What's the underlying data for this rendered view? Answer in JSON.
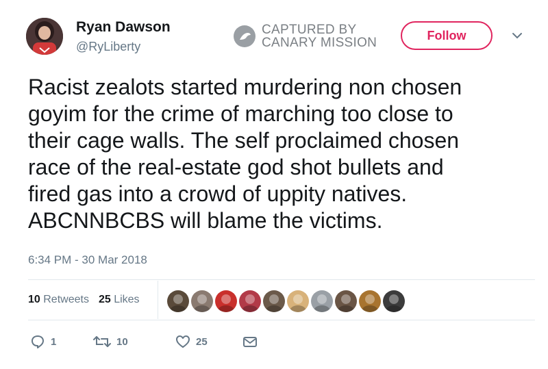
{
  "author": {
    "name": "Ryan Dawson",
    "handle": "@RyLiberty"
  },
  "watermark": {
    "line1": "CAPTURED BY",
    "line2": "CANARY MISSION"
  },
  "follow_button": {
    "label": "Follow"
  },
  "tweet": {
    "text": "Racist zealots started murdering non chosen\ngoyim for the crime of marching too close to\ntheir cage walls. The self proclaimed chosen\nrace of the real-estate god shot bullets and\nfired gas into a crowd of uppity natives.\nABCNNBCBS will blame the victims.",
    "timestamp": "6:34 PM - 30 Mar 2018"
  },
  "stats": {
    "retweets_count": "10",
    "retweets_label": "Retweets",
    "likes_count": "25",
    "likes_label": "Likes"
  },
  "actions": {
    "reply_count": "1",
    "retweet_count": "10",
    "like_count": "25"
  },
  "liker_avatar_colors": [
    "#5a4a3a",
    "#8a7a70",
    "#c9302c",
    "#b23a48",
    "#6b5a4a",
    "#d8b27a",
    "#9aa0a6",
    "#6a5545",
    "#a8742f",
    "#3c3c3c"
  ],
  "colors": {
    "accent": "#e0245e",
    "muted": "#657786",
    "text": "#14171a"
  }
}
